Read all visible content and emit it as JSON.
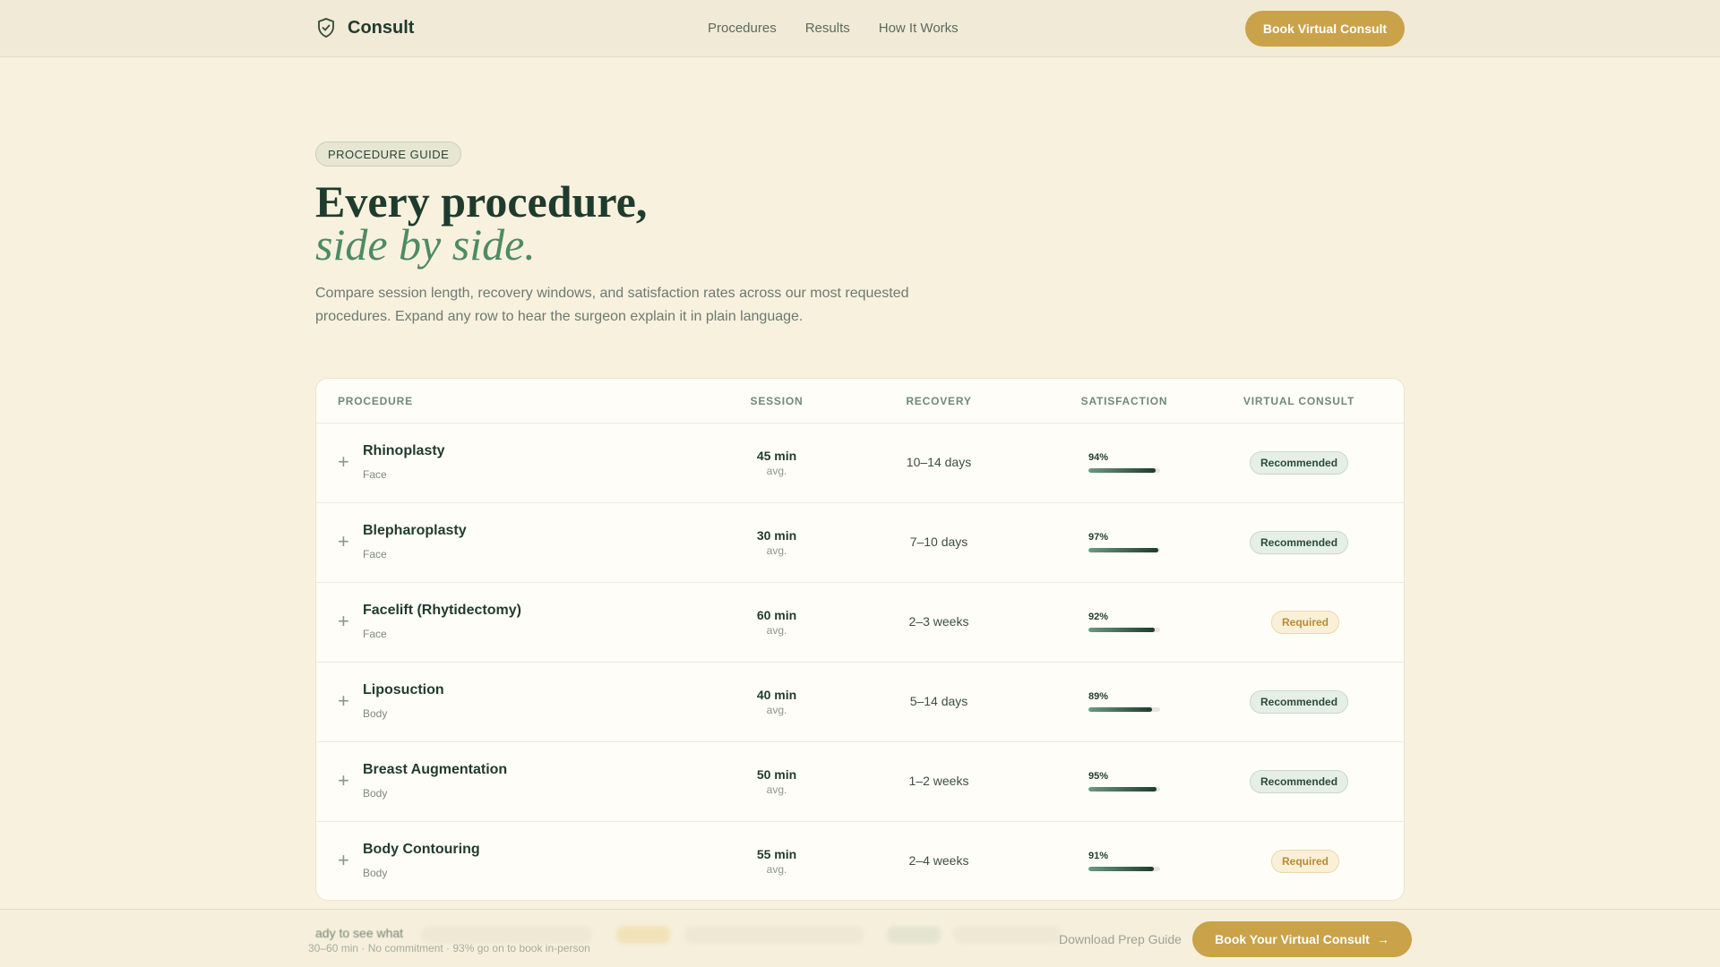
{
  "nav": {
    "brand": "Consult",
    "links": [
      "Procedures",
      "Results",
      "How It Works"
    ],
    "cta": "Book Virtual Consult"
  },
  "hero": {
    "pill": "PROCEDURE GUIDE",
    "title": "Every procedure,",
    "title_em": "side by side.",
    "lead": "Compare session length, recovery windows, and satisfaction rates across our most requested procedures. Expand any row to hear the surgeon explain it in plain language."
  },
  "table": {
    "headers": [
      "PROCEDURE",
      "SESSION",
      "RECOVERY",
      "SATISFACTION",
      "VIRTUAL CONSULT"
    ],
    "session_unit": "avg.",
    "rows": [
      {
        "name": "Rhinoplasty",
        "category": "Face",
        "session": "45 min",
        "recovery": "10–14 days",
        "satisfaction": "94%",
        "satisfaction_value": 94,
        "consult": "Recommended",
        "consult_type": "recommended"
      },
      {
        "name": "Blepharoplasty",
        "category": "Face",
        "session": "30 min",
        "recovery": "7–10 days",
        "satisfaction": "97%",
        "satisfaction_value": 97,
        "consult": "Recommended",
        "consult_type": "recommended"
      },
      {
        "name": "Facelift (Rhytidectomy)",
        "category": "Face",
        "session": "60 min",
        "recovery": "2–3 weeks",
        "satisfaction": "92%",
        "satisfaction_value": 92,
        "consult": "Required",
        "consult_type": "required"
      },
      {
        "name": "Liposuction",
        "category": "Body",
        "session": "40 min",
        "recovery": "5–14 days",
        "satisfaction": "89%",
        "satisfaction_value": 89,
        "consult": "Recommended",
        "consult_type": "recommended"
      },
      {
        "name": "Breast Augmentation",
        "category": "Body",
        "session": "50 min",
        "recovery": "1–2 weeks",
        "satisfaction": "95%",
        "satisfaction_value": 95,
        "consult": "Recommended",
        "consult_type": "recommended"
      },
      {
        "name": "Body Contouring",
        "category": "Body",
        "session": "55 min",
        "recovery": "2–4 weeks",
        "satisfaction": "91%",
        "satisfaction_value": 91,
        "consult": "Required",
        "consult_type": "required"
      }
    ]
  },
  "footer": {
    "title_fragment": "ady to see what",
    "subtitle": "30–60 min · No commitment · 93% go on to book in-person",
    "secondary_link": "Download Prep Guide",
    "cta": "Book Your Virtual Consult",
    "cta_arrow": "→"
  },
  "colors": {
    "background": "#f8f1de",
    "primary_text": "#1f3b2e",
    "accent_green": "#4e8a66",
    "accent_gold": "#c9a24a",
    "recommended": "#2c4a38",
    "required": "#b88a36"
  },
  "icons": {
    "brand": "shield-check-icon",
    "row_expand": "plus-icon",
    "cta_arrow": "arrow-right-icon"
  }
}
